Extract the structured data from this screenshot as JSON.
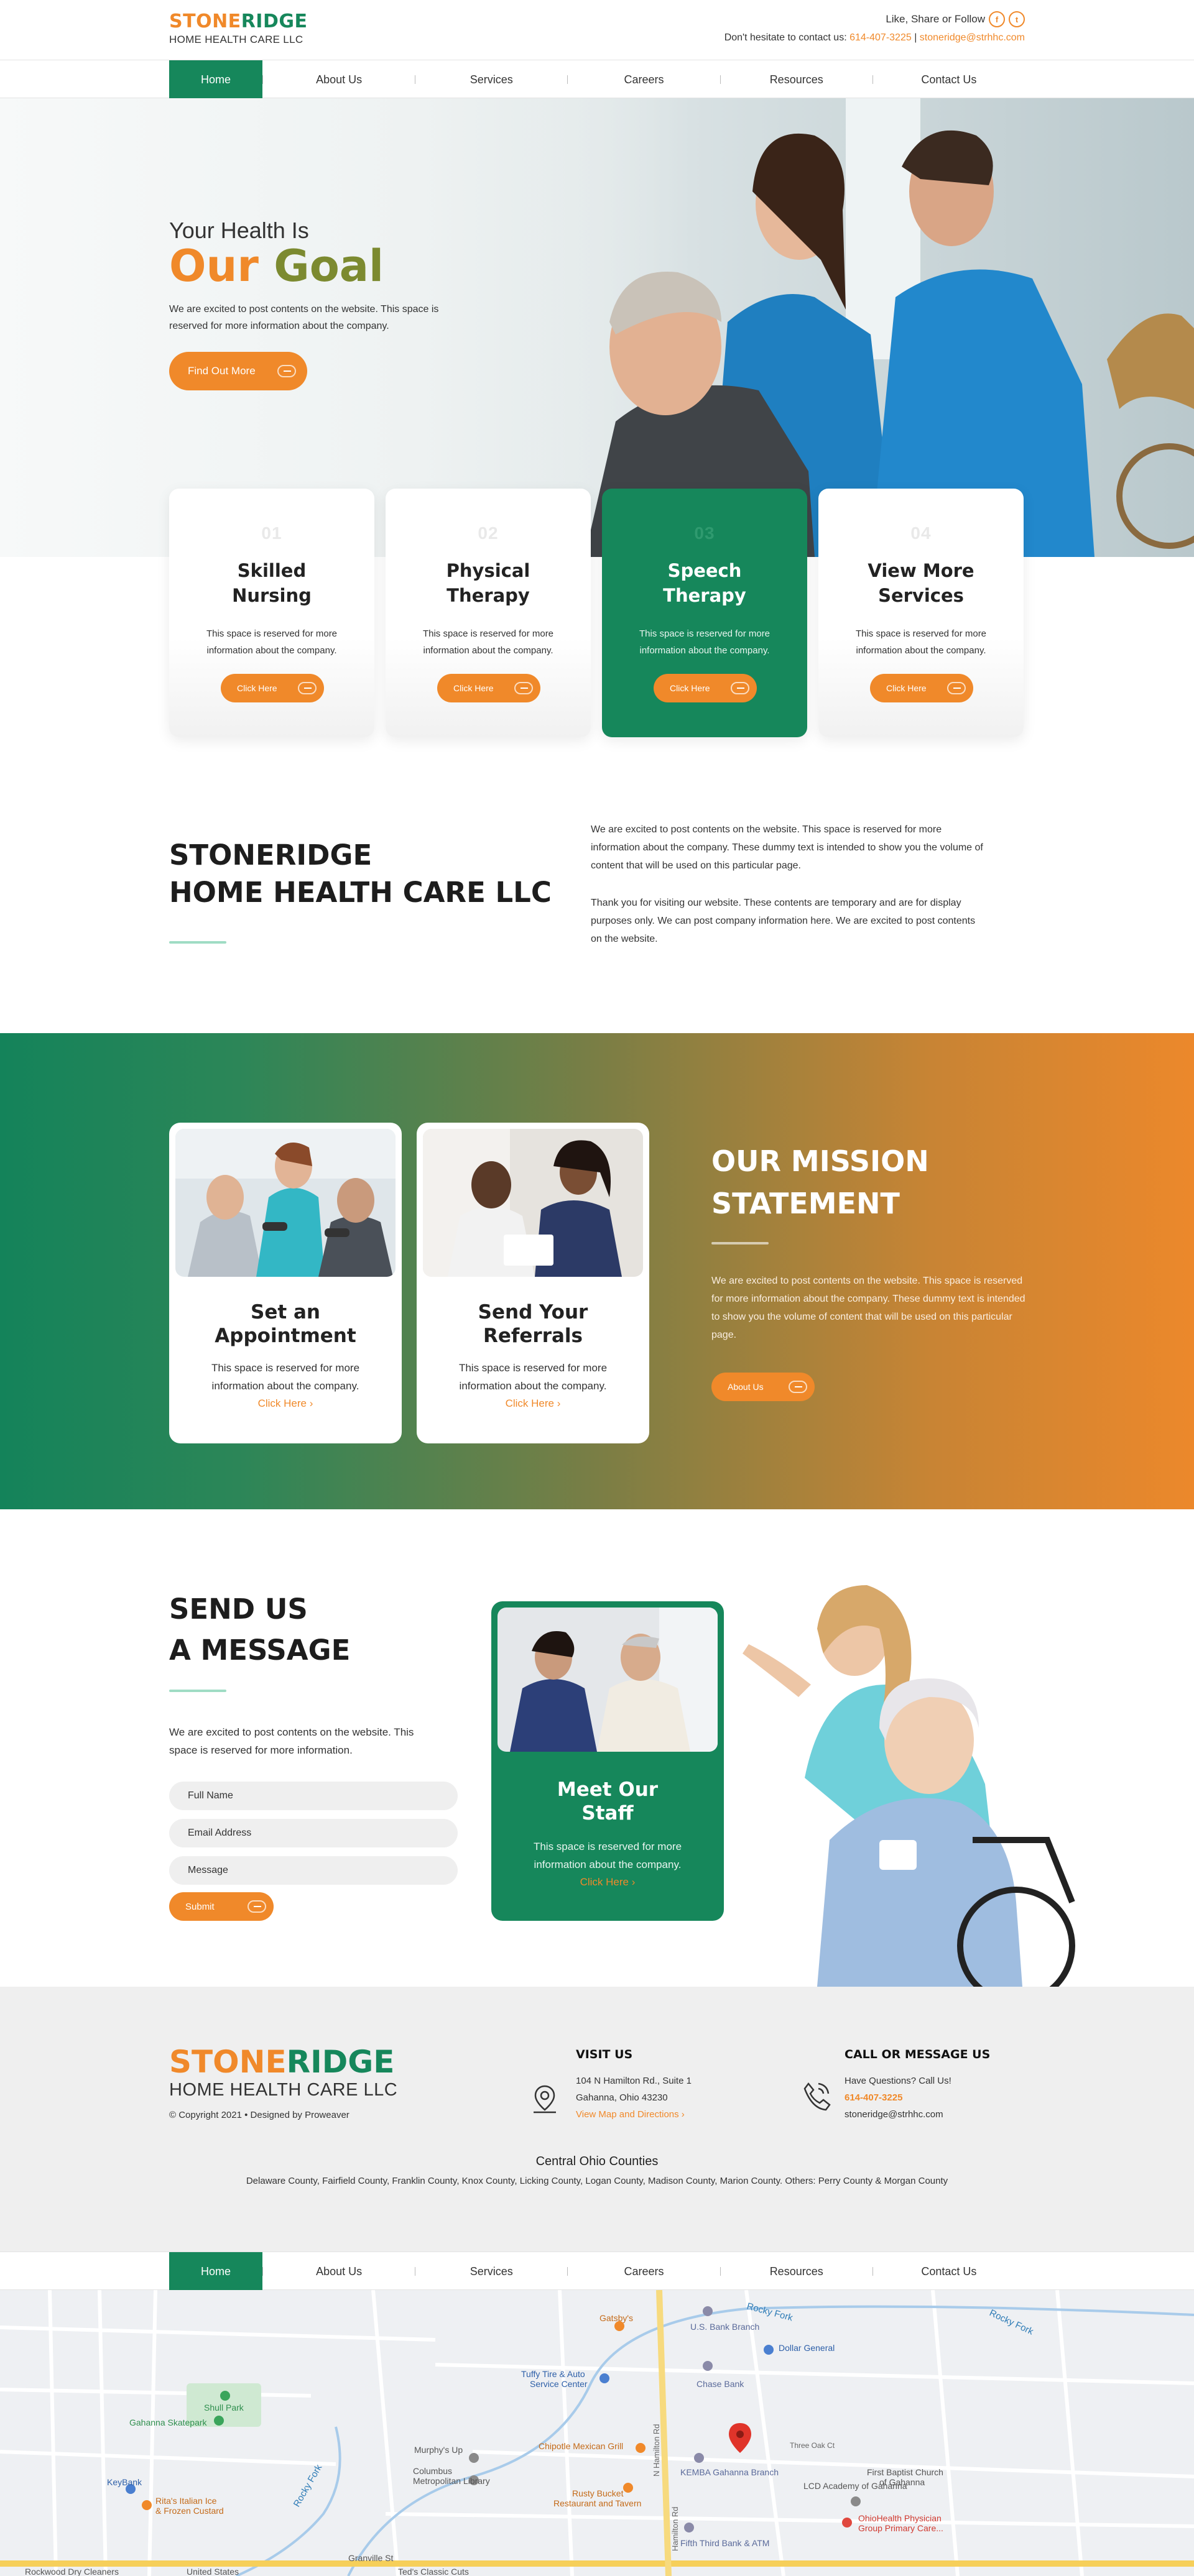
{
  "header": {
    "logo_part1": "STONE",
    "logo_part2": "RIDGE",
    "logo_sub": "HOME HEALTH CARE LLC",
    "follow_text": "Like, Share or Follow",
    "facebook_icon": "facebook-icon",
    "twitter_icon": "twitter-icon",
    "contact_prefix": "Don't hesitate to contact us:",
    "phone": "614-407-3225",
    "separator": "|",
    "email": "stoneridge@strhhc.com"
  },
  "nav": {
    "items": [
      "Home",
      "About Us",
      "Services",
      "Careers",
      "Resources",
      "Contact Us"
    ],
    "active": "Home"
  },
  "hero": {
    "kicker": "Your Health Is",
    "title_part1": "Our ",
    "title_part2": "Goal",
    "text": "We are excited to post contents on the website. This space is reserved for more information about the company.",
    "button": "Find Out More"
  },
  "services": [
    {
      "num": "01",
      "title_l1": "Skilled",
      "title_l2": "Nursing",
      "text": "This space is reserved for more information about the company.",
      "button": "Click Here"
    },
    {
      "num": "02",
      "title_l1": "Physical",
      "title_l2": "Therapy",
      "text": "This space is reserved for more information about the company.",
      "button": "Click Here"
    },
    {
      "num": "03",
      "title_l1": "Speech",
      "title_l2": "Therapy",
      "text": "This space is reserved for more information about the company.",
      "button": "Click Here"
    },
    {
      "num": "04",
      "title_l1": "View More",
      "title_l2": "Services",
      "text": "This space is reserved for more information about the company.",
      "button": "Click Here"
    }
  ],
  "about": {
    "title_l1": "STONERIDGE",
    "title_l2": "HOME HEALTH CARE LLC",
    "p1": "We are excited to post contents on the website. This space is reserved for more information about the company. These dummy text is intended to show you the volume of content that will be used on this particular page.",
    "p2": "Thank you for visiting our website. These contents are temporary and are for display purposes only. We can post company information here.  We are excited to post contents on the website."
  },
  "mission": {
    "cards": [
      {
        "title_l1": "Set an",
        "title_l2": "Appointment",
        "text": "This space is reserved for more information about the company.",
        "link": "Click Here ›"
      },
      {
        "title_l1": "Send Your",
        "title_l2": "Referrals",
        "text": "This space is reserved for more information about the company.",
        "link": "Click Here ›"
      }
    ],
    "title_l1": "OUR MISSION",
    "title_l2": "STATEMENT",
    "text": "We are excited to post contents on the website. This space is reserved for more information about the company. These dummy text is intended to show you the volume of content that will be used on this particular page.",
    "button": "About Us"
  },
  "message": {
    "title_l1": "SEND US",
    "title_l2": "A MESSAGE",
    "text": "We are excited to post contents on the website. This space is reserved for more information.",
    "fields": [
      "Full Name",
      "Email Address",
      "Message"
    ],
    "submit": "Submit",
    "staff": {
      "title_l1": "Meet Our",
      "title_l2": "Staff",
      "text": "This space is reserved for more information about the company.",
      "link": "Click Here ›"
    }
  },
  "footer": {
    "logo_part1": "STONE",
    "logo_part2": "RIDGE",
    "logo_sub": "HOME HEALTH CARE LLC",
    "copyright": "© Copyright 2021 • Designed by Proweaver",
    "visit_heading": "VISIT US",
    "address_l1": "104 N Hamilton Rd., Suite 1",
    "address_l2": "Gahanna, Ohio 43230",
    "map_link": "View Map and Directions ›",
    "call_heading": "CALL OR MESSAGE US",
    "call_prompt": "Have Questions? Call Us!",
    "phone": "614-407-3225",
    "email": "stoneridge@strhhc.com",
    "counties_heading": "Central Ohio Counties",
    "counties": "Delaware County, Fairfield County, Franklin County, Knox County, Licking County, Logan County, Madison County, Marion County. Others: Perry County & Morgan County"
  },
  "map": {
    "labels": {
      "shull_park": "Shull Park",
      "skatepark": "Gahanna Skatepark",
      "keybank": "KeyBank",
      "ritas": "Rita's Italian Ice",
      "ritas2": "& Frozen Custard",
      "murphys": "Murphy's Up",
      "columbus_lib": "Columbus",
      "columbus_lib2": "Metropolitan Library",
      "chipotle": "Chipotle Mexican Grill",
      "rusty": "Rusty Bucket",
      "rusty2": "Restaurant and Tavern",
      "tuffy": "Tuffy Tire & Auto",
      "tuffy2": "Service Center",
      "gatsbys": "Gatsby's",
      "usbank": "U.S. Bank Branch",
      "dollar": "Dollar General",
      "chase": "Chase Bank",
      "kemba": "KEMBA Gahanna Branch",
      "fifth": "Fifth Third Bank & ATM",
      "lcd": "LCD Academy of Gahanna",
      "first_baptist": "First Baptist Church",
      "first_baptist2": "of Gahanna",
      "ohiohealth": "OhioHealth Physician",
      "ohiohealth2": "Group Primary Care...",
      "rocky_fork": "Rocky Fork",
      "rocky_fork2": "Rocky Fork",
      "rocky_fork3": "Rocky Fork",
      "granville": "Granville St",
      "teds": "Ted's Classic Cuts",
      "rockwood": "Rockwood Dry Cleaners",
      "united_states": "United States",
      "three_oak": "Three Oak Ct",
      "hamilton": "N Hamilton Rd",
      "hamilton2": "Hamilton Rd"
    }
  },
  "colors": {
    "green": "#16875b",
    "orange": "#f0892a"
  }
}
